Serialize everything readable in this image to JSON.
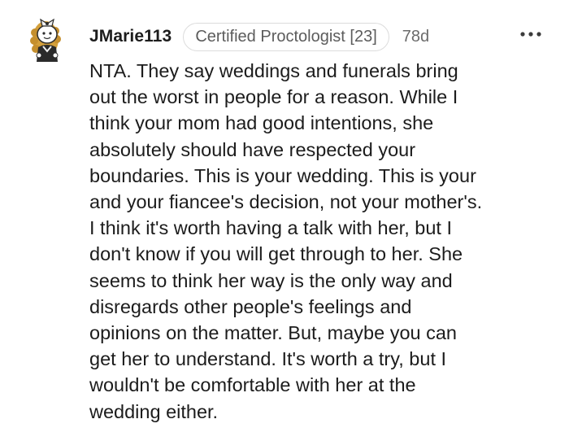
{
  "comment": {
    "author": "JMarie113",
    "flair": "Certified Proctologist [23]",
    "age": "78d",
    "more_icon": "more-horizontal-icon",
    "avatar_icon": "snoo-avatar-icon",
    "body": "NTA. They say weddings and funerals bring\nout the worst in people for a reason. While I\nthink your mom had good intentions, she\nabsolutely should have respected your\nboundaries. This is your wedding. This is your\nand your fiancee's decision, not your mother's.\nI think it's worth having a talk with her, but I\ndon't know if you will get through to her. She\nseems to think her way is the only way and\ndisregards other people's feelings and\nopinions on the matter. But, maybe you can\nget her to understand. It's worth a try, but I\nwouldn't be comfortable with her at the\nwedding either."
  },
  "colors": {
    "text": "#1c1c1c",
    "meta": "#6b6b6b",
    "flair_border": "#dcdcdc",
    "avatar_hair": "#d4a03c",
    "avatar_outfit": "#2b2b2b"
  }
}
